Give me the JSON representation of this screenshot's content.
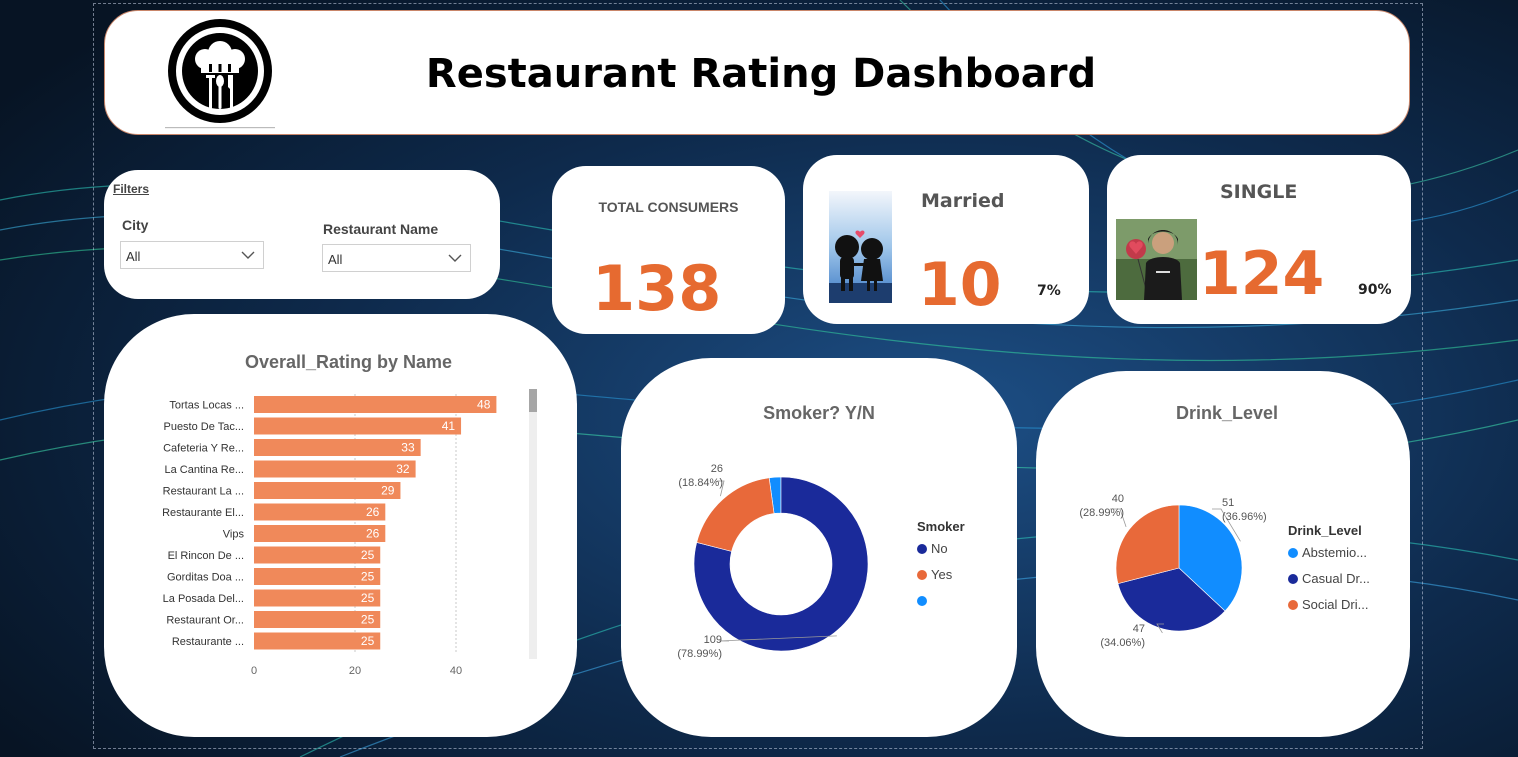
{
  "header": {
    "title": "Restaurant Rating Dashboard"
  },
  "filters": {
    "title": "Filters",
    "city_label": "City",
    "city_value": "All",
    "restaurant_label": "Restaurant Name",
    "restaurant_value": "All"
  },
  "kpis": {
    "total": {
      "label": "TOTAL CONSUMERS",
      "value": "138"
    },
    "married": {
      "label": "Married",
      "value": "10",
      "pct": "7%"
    },
    "single": {
      "label": "SINGLE",
      "value": "124",
      "pct": "90%"
    }
  },
  "colors": {
    "accent": "#e66a30",
    "bar": "#f0895a",
    "navy": "#1a2a9a",
    "orange": "#e8693a",
    "blue": "#118dff"
  },
  "chart_data": [
    {
      "type": "bar",
      "orientation": "horizontal",
      "title": "Overall_Rating by Name",
      "categories": [
        "Tortas Locas ...",
        "Puesto De Tac...",
        "Cafeteria Y Re...",
        "La Cantina Re...",
        "Restaurant La ...",
        "Restaurante El...",
        "Vips",
        "El Rincon De ...",
        "Gorditas Doa ...",
        "La Posada Del...",
        "Restaurant Or...",
        "Restaurante ..."
      ],
      "values": [
        48,
        41,
        33,
        32,
        29,
        26,
        26,
        25,
        25,
        25,
        25,
        25
      ],
      "xlim": [
        0,
        48
      ],
      "xticks": [
        0,
        20,
        40
      ],
      "grid": true
    },
    {
      "type": "pie",
      "variant": "donut",
      "title": "Smoker? Y/N",
      "legend_title": "Smoker",
      "legend_position": "right",
      "slices": [
        {
          "label": "No",
          "value": 109,
          "pct": "(78.99%)",
          "color": "#1a2a9a"
        },
        {
          "label": "Yes",
          "value": 26,
          "pct": "(18.84%)",
          "color": "#e8693a"
        },
        {
          "label": "",
          "value": 3,
          "pct": "",
          "color": "#118dff"
        }
      ]
    },
    {
      "type": "pie",
      "title": "Drink_Level",
      "legend_title": "Drink_Level",
      "legend_position": "right",
      "slices": [
        {
          "label": "Abstemio...",
          "value": 51,
          "pct": "(36.96%)",
          "color": "#118dff"
        },
        {
          "label": "Casual Dr...",
          "value": 47,
          "pct": "(34.06%)",
          "color": "#1a2a9a"
        },
        {
          "label": "Social Dri...",
          "value": 40,
          "pct": "(28.99%)",
          "color": "#e8693a"
        }
      ]
    }
  ]
}
